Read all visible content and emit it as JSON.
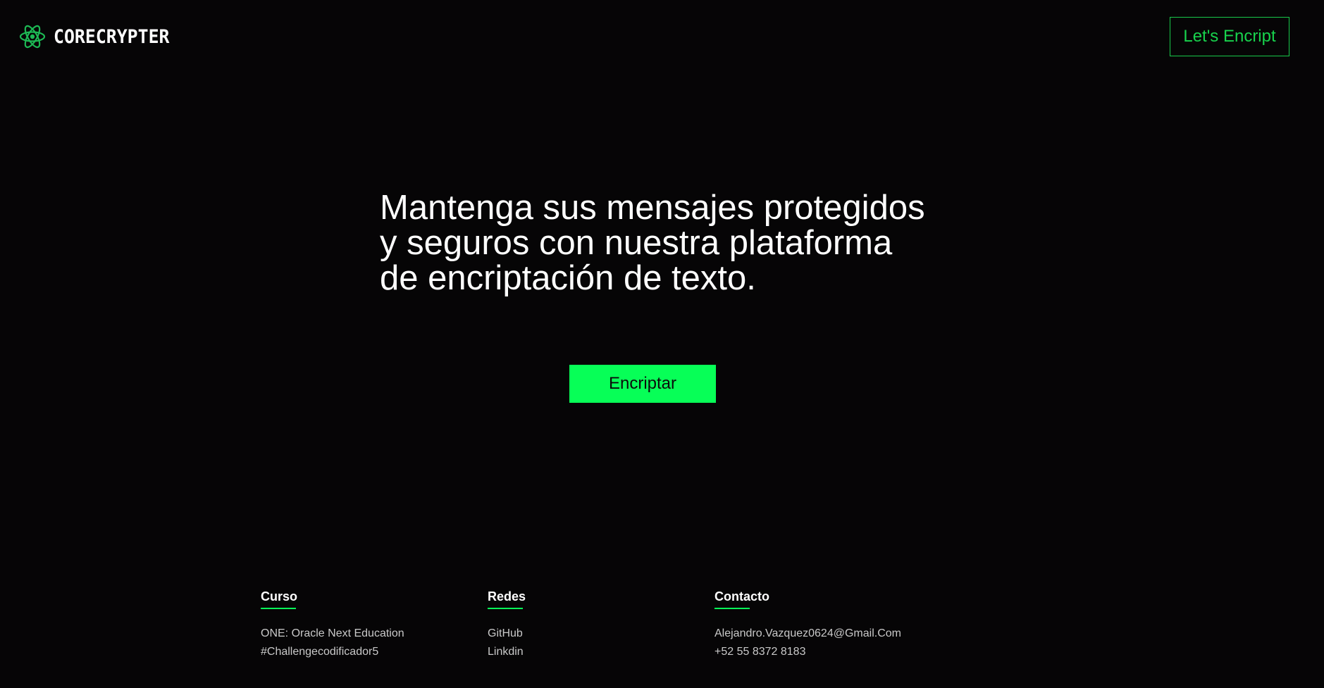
{
  "header": {
    "brand_name": "CORECRYPTER",
    "logo_icon": "atom-icon",
    "cta_label": "Let's Encript"
  },
  "hero": {
    "title_lines": [
      "Mantenga sus mensajes protegidos",
      "y seguros con nuestra plataforma",
      "de encriptación de texto."
    ],
    "button_label": "Encriptar"
  },
  "footer": {
    "columns": [
      {
        "title": "Curso",
        "items": [
          "ONE: Oracle Next Education",
          "#Challengecodificador5"
        ]
      },
      {
        "title": "Redes",
        "items": [
          "GitHub",
          "Linkdin"
        ]
      },
      {
        "title": "Contacto",
        "items": [
          "Alejandro.Vazquez0624@Gmail.Com",
          "+52 55 8372 8183"
        ]
      }
    ]
  },
  "colors": {
    "background": "#060506",
    "accent": "#07ff57",
    "accent_outline": "#18c94a",
    "text": "#ffffff",
    "muted_text": "#c9c9c9"
  }
}
